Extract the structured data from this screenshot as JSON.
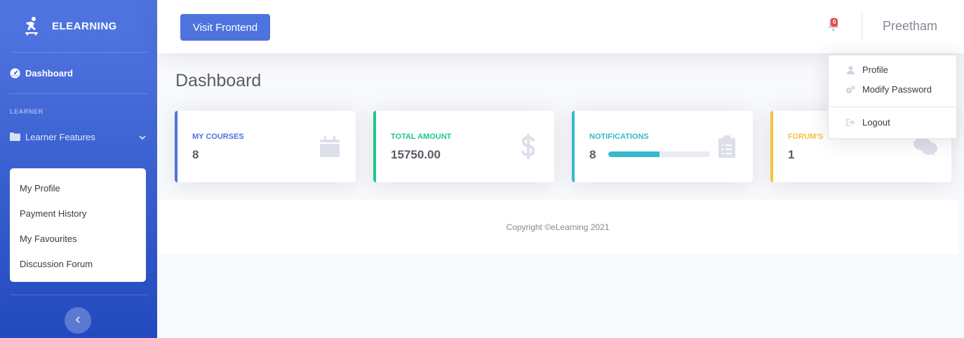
{
  "sidebar": {
    "brand": "ELEARNING",
    "dashboard_label": "Dashboard",
    "section_heading": "LEARNER",
    "learner_features_label": "Learner Features",
    "sub_items": [
      {
        "label": "My Profile"
      },
      {
        "label": "Payment History"
      },
      {
        "label": "My Favourites"
      },
      {
        "label": "Discussion Forum"
      }
    ]
  },
  "topbar": {
    "visit_button": "Visit Frontend",
    "notification_count": "0",
    "username": "Preetham"
  },
  "dropdown": {
    "profile": "Profile",
    "modify_password": "Modify Password",
    "logout": "Logout"
  },
  "main": {
    "page_title": "Dashboard",
    "cards": [
      {
        "label": "My Courses",
        "value": "8",
        "color": "#4e73df"
      },
      {
        "label": "Total Amount",
        "value": "15750.00",
        "color": "#1cc88a"
      },
      {
        "label": "Notifications",
        "value": "8",
        "color": "#36b9cc",
        "progress_percent": 50
      },
      {
        "label": "Forum's",
        "value": "1",
        "color": "#f6c23e"
      }
    ]
  },
  "footer": {
    "text": "Copyright ©eLearning 2021"
  }
}
